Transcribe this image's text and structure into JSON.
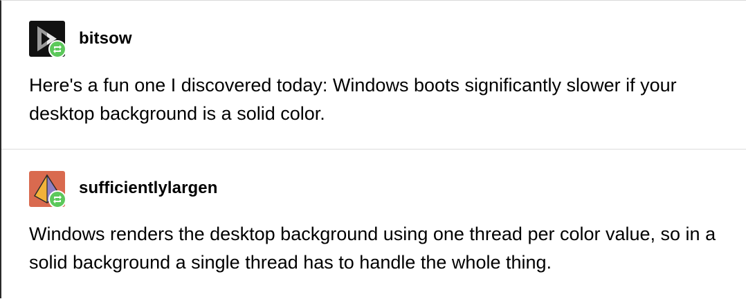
{
  "posts": [
    {
      "username": "bitsow",
      "avatar_icon": "play-logo-icon",
      "reblog_icon": "reblog-icon",
      "text": "Here's a fun one I discovered today: Windows boots significantly slower if your desktop background is a solid color."
    },
    {
      "username": "sufficientlylargen",
      "avatar_icon": "pyramid-logo-icon",
      "reblog_icon": "reblog-icon",
      "text": "Windows renders the desktop background using one thread per color value, so in a solid background a single thread has to handle the whole thing."
    }
  ],
  "colors": {
    "reblog_badge": "#5cc85b",
    "avatar_1_bg": "#111111",
    "avatar_2_bg": "#d96a4f",
    "divider": "#dcdcdc"
  }
}
